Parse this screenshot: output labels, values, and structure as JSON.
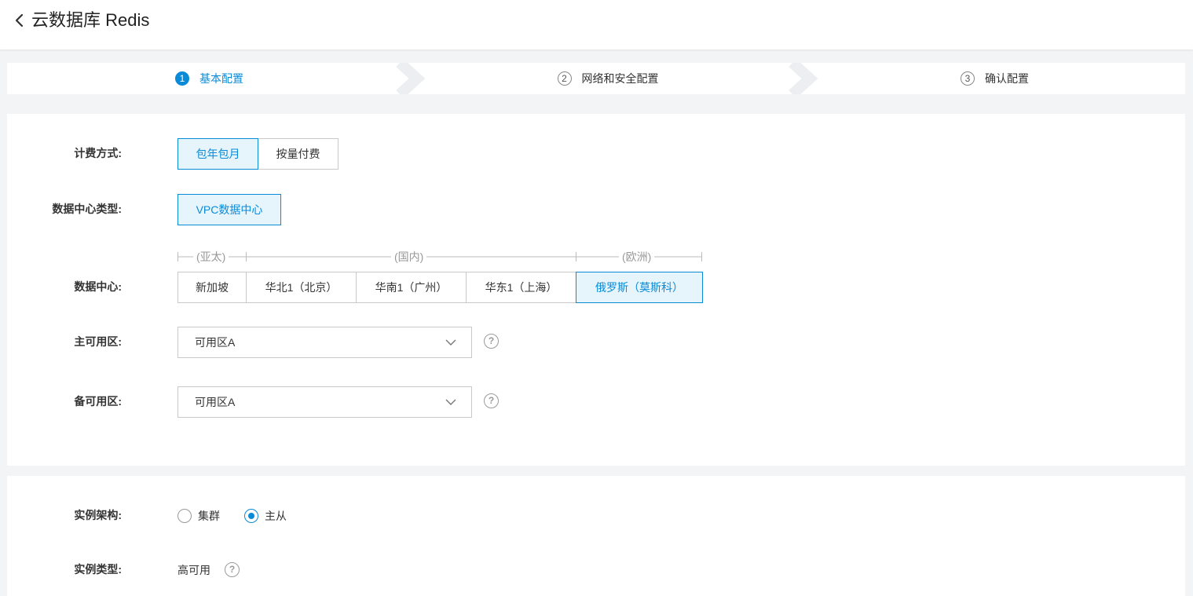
{
  "header": {
    "title": "云数据库 Redis",
    "back_icon": "chevron-left-icon"
  },
  "steps": [
    {
      "num": "1",
      "label": "基本配置",
      "active": true
    },
    {
      "num": "2",
      "label": "网络和安全配置",
      "active": false
    },
    {
      "num": "3",
      "label": "确认配置",
      "active": false
    }
  ],
  "form": {
    "billing": {
      "label": "计费方式:",
      "options": [
        "包年包月",
        "按量付费"
      ],
      "selected": "包年包月"
    },
    "dc_type": {
      "label": "数据中心类型:",
      "options": [
        "VPC数据中心"
      ],
      "selected": "VPC数据中心"
    },
    "region_groups": [
      "(亚太)",
      "(国内)",
      "(欧洲)"
    ],
    "datacenter": {
      "label": "数据中心:",
      "options": [
        "新加坡",
        "华北1（北京）",
        "华南1（广州）",
        "华东1（上海）",
        "俄罗斯（莫斯科）"
      ],
      "selected": "俄罗斯（莫斯科）"
    },
    "primary_zone": {
      "label": "主可用区:",
      "value": "可用区A",
      "help": "?"
    },
    "backup_zone": {
      "label": "备可用区:",
      "value": "可用区A",
      "help": "?"
    }
  },
  "arch": {
    "label": "实例架构:",
    "options": [
      "集群",
      "主从"
    ],
    "selected": "主从"
  },
  "instance_type": {
    "label": "实例类型:",
    "value": "高可用",
    "help": "?"
  },
  "colors": {
    "accent": "#0a8bd7",
    "selected_bg": "#e6f4fc",
    "page_bg": "#f3f4f6"
  }
}
